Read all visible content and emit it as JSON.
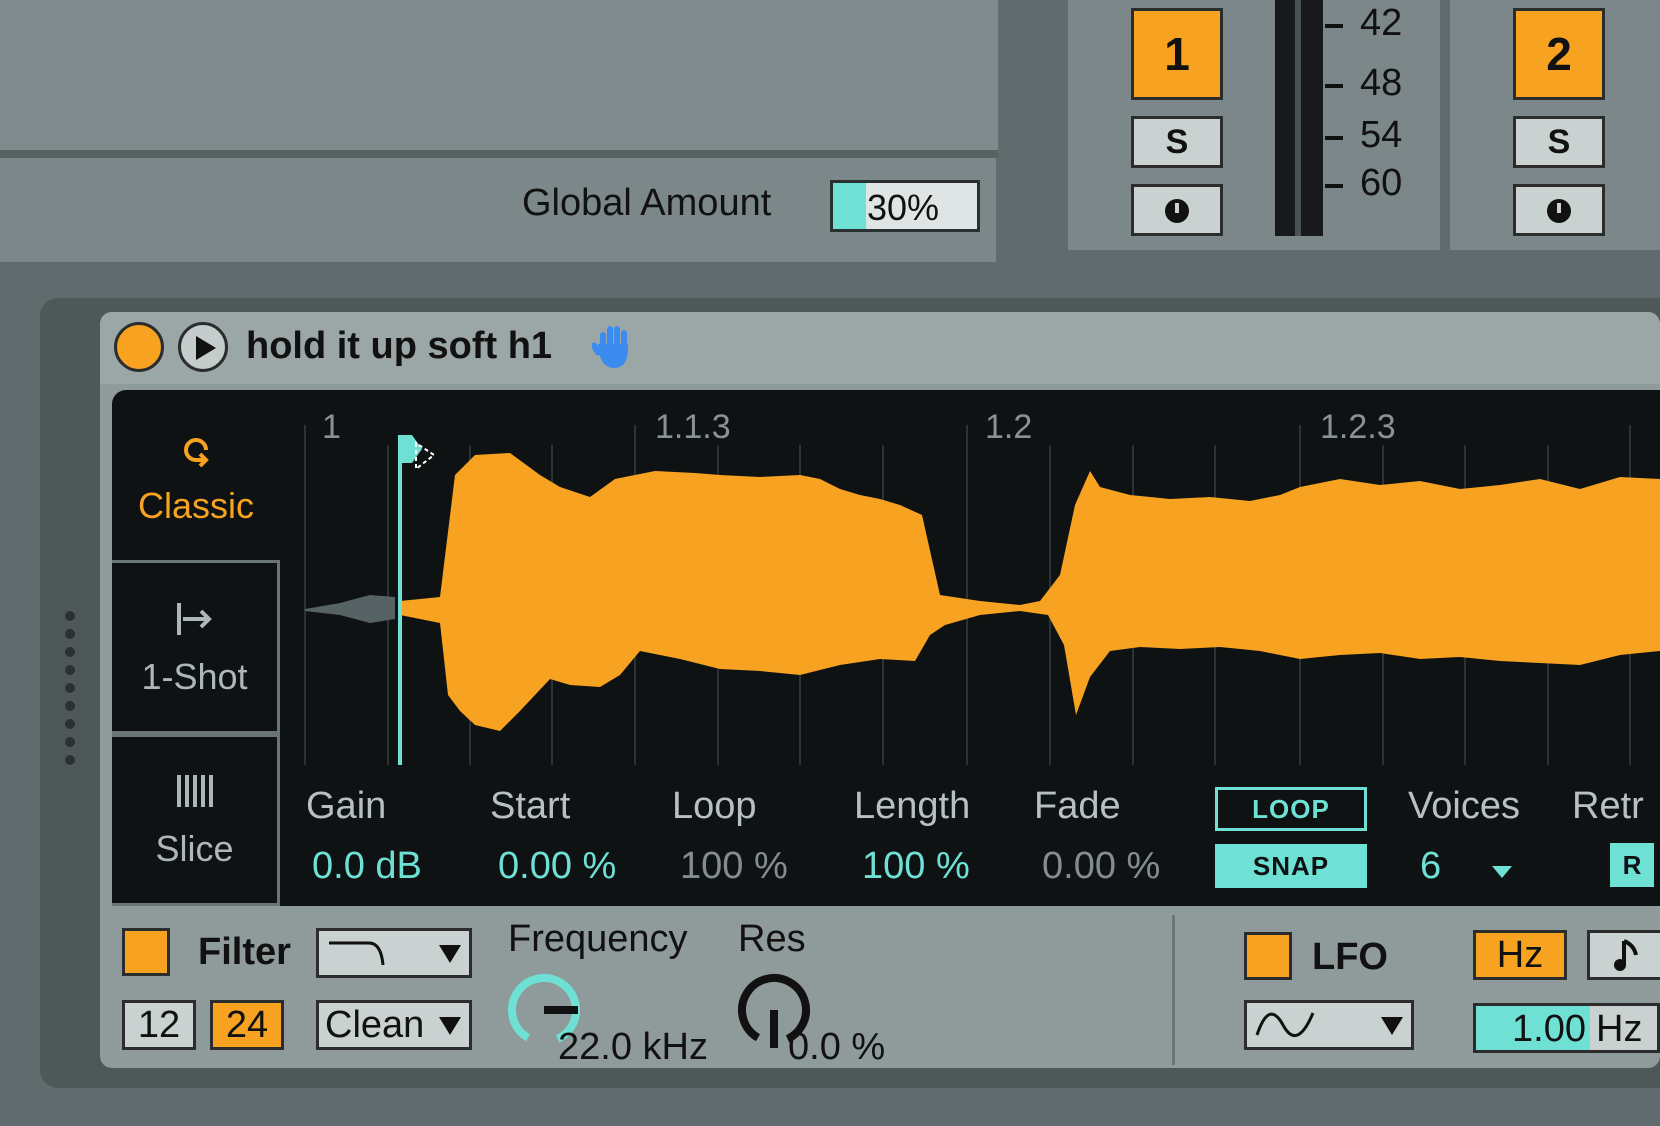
{
  "macro": {
    "global_amount_label": "Global Amount",
    "global_amount_value": "30%",
    "global_amount_fraction": 0.3
  },
  "mixer": {
    "tracks": [
      {
        "number": "1",
        "solo": "S",
        "color": "#f7a221"
      },
      {
        "number": "2",
        "solo": "S",
        "color": "#f7a221"
      }
    ],
    "meter_ticks": [
      "42",
      "48",
      "54",
      "60"
    ]
  },
  "device": {
    "sample_name": "hold it up soft h1",
    "hand_icon": "hand-icon",
    "modes": [
      "Classic",
      "1-Shot",
      "Slice"
    ],
    "selected_mode": "Classic",
    "timeline": [
      "1",
      "1.1.3",
      "1.2",
      "1.2.3"
    ],
    "params": {
      "gain": {
        "label": "Gain",
        "value": "0.0 dB"
      },
      "start": {
        "label": "Start",
        "value": "0.00 %"
      },
      "loop": {
        "label": "Loop",
        "value": "100 %"
      },
      "length": {
        "label": "Length",
        "value": "100 %"
      },
      "fade": {
        "label": "Fade",
        "value": "0.00 %"
      },
      "voices": {
        "label": "Voices",
        "value": "6"
      },
      "retrig": {
        "label": "Retr",
        "button": "R"
      }
    },
    "loop_button": "LOOP",
    "snap_button": "SNAP",
    "filter": {
      "label": "Filter",
      "slope_12": "12",
      "slope_24": "24",
      "circuit": "Clean",
      "frequency_label": "Frequency",
      "frequency_value": "22.0 kHz",
      "res_label": "Res",
      "res_value": "0.0 %"
    },
    "lfo": {
      "label": "LFO",
      "hz_button": "Hz",
      "rate_value": "1.00",
      "rate_unit": "Hz",
      "rate_fraction": 0.45
    }
  },
  "colors": {
    "accent": "#f7a221",
    "highlight": "#6ee0d4",
    "display_bg": "#0f1213"
  }
}
